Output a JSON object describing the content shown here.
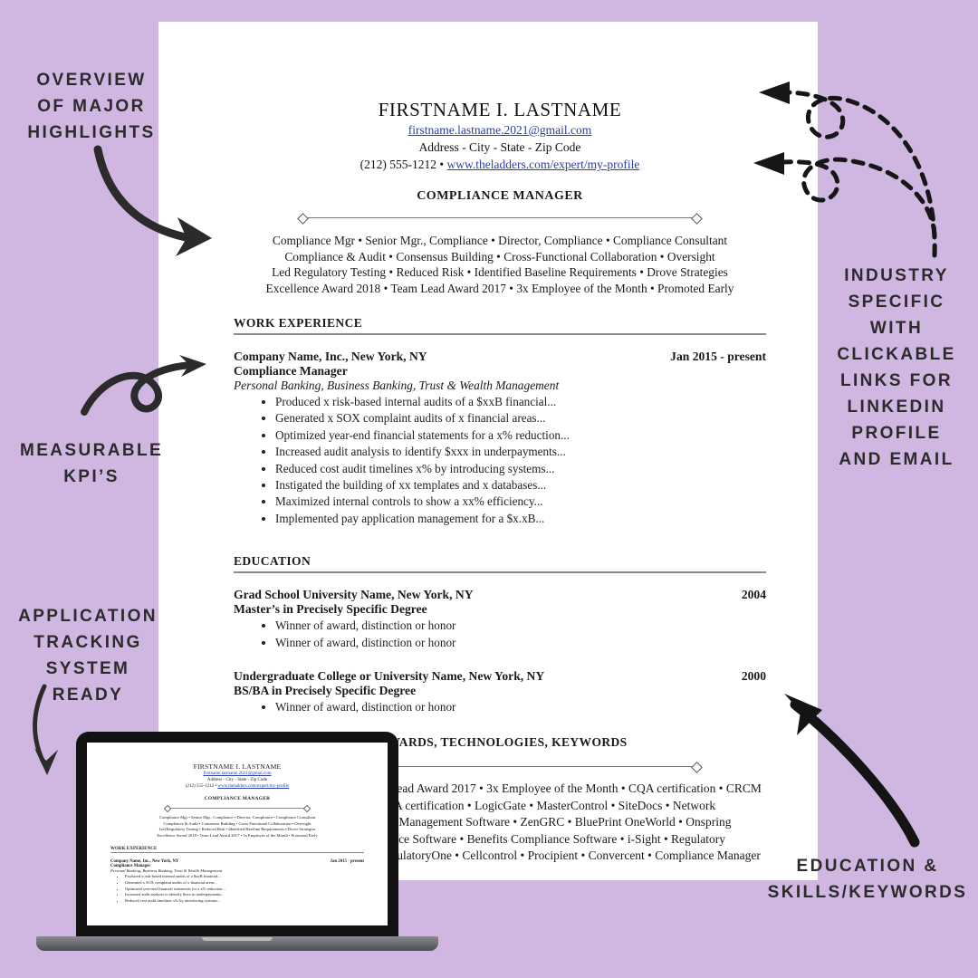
{
  "colors": {
    "background": "#cfb7e1",
    "page": "#ffffff",
    "link": "#2a3ea8",
    "ink": "#1a1a1a",
    "rule": "#8a8a8a"
  },
  "resume": {
    "name": "FIRSTNAME I. LASTNAME",
    "email": "firstname.lastname.2021@gmail.com",
    "address": "Address - City - State - Zip Code",
    "phone": "(212) 555-1212",
    "separator": "•",
    "website": "www.theladders.com/expert/my-profile",
    "target_title": "COMPLIANCE MANAGER",
    "keyword_lines": [
      "Compliance Mgr • Senior Mgr., Compliance • Director, Compliance • Compliance Consultant",
      "Compliance & Audit • Consensus Building • Cross-Functional Collaboration • Oversight",
      "Led Regulatory Testing • Reduced Risk • Identified Baseline Requirements • Drove Strategies",
      "Excellence Award 2018 • Team Lead Award 2017 • 3x Employee of the Month • Promoted Early"
    ],
    "sections": {
      "work_experience": {
        "heading": "WORK EXPERIENCE",
        "company": "Company Name, Inc., New York, NY",
        "dates": "Jan 2015 - present",
        "role": "Compliance Manager",
        "scope": "Personal Banking, Business Banking, Trust & Wealth Management",
        "bullets": [
          "Produced x risk-based internal audits of a $xxB financial...",
          "Generated x SOX complaint audits of x financial areas...",
          "Optimized year-end financial statements for a x% reduction...",
          "Increased audit analysis to identify $xxx in underpayments...",
          "Reduced cost audit timelines x% by introducing systems...",
          "Instigated the building of xx templates and x databases...",
          "Maximized internal controls to show a xx% efficiency...",
          "Implemented pay application management for a $x.xB..."
        ]
      },
      "education": {
        "heading": "EDUCATION",
        "entries": [
          {
            "school": "Grad School University Name, New York, NY",
            "year": "2004",
            "degree": "Master’s in Precisely Specific Degree",
            "bullets": [
              "Winner of award, distinction or honor",
              "Winner of award, distinction or honor"
            ]
          },
          {
            "school": "Undergraduate College or University Name, New York, NY",
            "year": "2000",
            "degree": "BS/BA in Precisely Specific Degree",
            "bullets": [
              "Winner of award, distinction or honor"
            ]
          }
        ]
      },
      "optional": {
        "heading": "OPTIONAL PERSONAL, AWARDS, TECHNOLOGIES, KEYWORDS",
        "paragraph": "Excellence Award 2018 • Team Lead Award 2017 • 3x Employee of the Month • CQA certification • CRCM certification • CAMS-Audit • CPA certification • LogicGate • MasterControl • SiteDocs • Network Configuration Manager • Quality Management Software • ZenGRC • BluePrint OneWorld • Onspring Compliance Software • Compliance Software • Benefits Compliance Software • i-Sight • Regulatory Onboarding & Compliance • RegulatoryOne • Cellcontrol • Procipient • Convercent • Compliance Manager"
      }
    }
  },
  "annotations": {
    "overview": "OVERVIEW\nOF MAJOR\nHIGHLIGHTS",
    "industry": "INDUSTRY\nSPECIFIC\nWITH\nCLICKABLE\nLINKS FOR\nLINKEDIN\nPROFILE\nAND EMAIL",
    "kpi": "MEASURABLE\nKPI’S",
    "ats": "APPLICATION\nTRACKING\nSYSTEM\nREADY",
    "education_skills": "EDUCATION &\nSKILLS/KEYWORDS"
  }
}
